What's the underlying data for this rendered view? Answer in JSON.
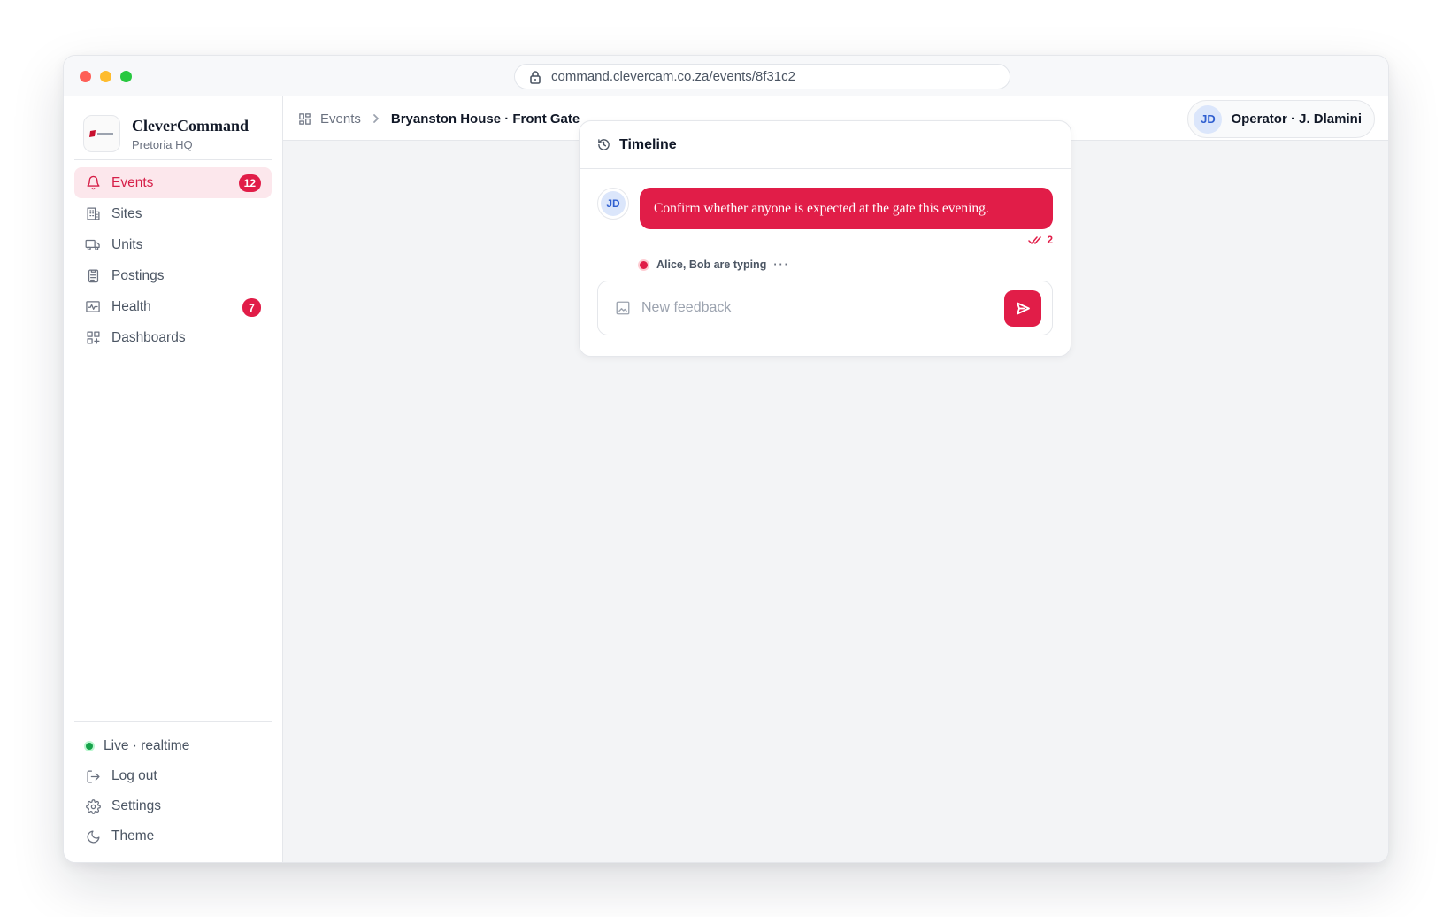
{
  "browser": {
    "url": "command.clevercam.co.za/events/8f31c2"
  },
  "brand": {
    "name": "CleverCommand",
    "subtitle": "Pretoria HQ"
  },
  "sidebar": {
    "items": [
      {
        "label": "Events",
        "icon": "bell-icon",
        "badge": "12",
        "active": true
      },
      {
        "label": "Sites",
        "icon": "building-icon"
      },
      {
        "label": "Units",
        "icon": "truck-icon"
      },
      {
        "label": "Postings",
        "icon": "clipboard-icon"
      },
      {
        "label": "Health",
        "icon": "activity-icon",
        "badge": "7"
      },
      {
        "label": "Dashboards",
        "icon": "dashboard-icon"
      }
    ],
    "bottom": [
      {
        "label": "Live · realtime",
        "icon": "status-dot"
      },
      {
        "label": "Log out",
        "icon": "logout-icon"
      },
      {
        "label": "Settings",
        "icon": "gear-icon"
      },
      {
        "label": "Theme",
        "icon": "moon-icon"
      }
    ]
  },
  "header": {
    "breadcrumb_root": "Events",
    "breadcrumb_current": "Bryanston House · Front Gate",
    "operator_initials": "JD",
    "operator_label": "Operator · J. Dlamini"
  },
  "timeline": {
    "title": "Timeline",
    "message": {
      "initials": "JD",
      "text": "Confirm whether anyone is expected at the gate this evening.",
      "read_count": "2"
    },
    "typing_text": "Alice, Bob are typing",
    "composer_placeholder": "New feedback"
  },
  "colors": {
    "accent": "#e11d48",
    "live": "#16a34a"
  }
}
